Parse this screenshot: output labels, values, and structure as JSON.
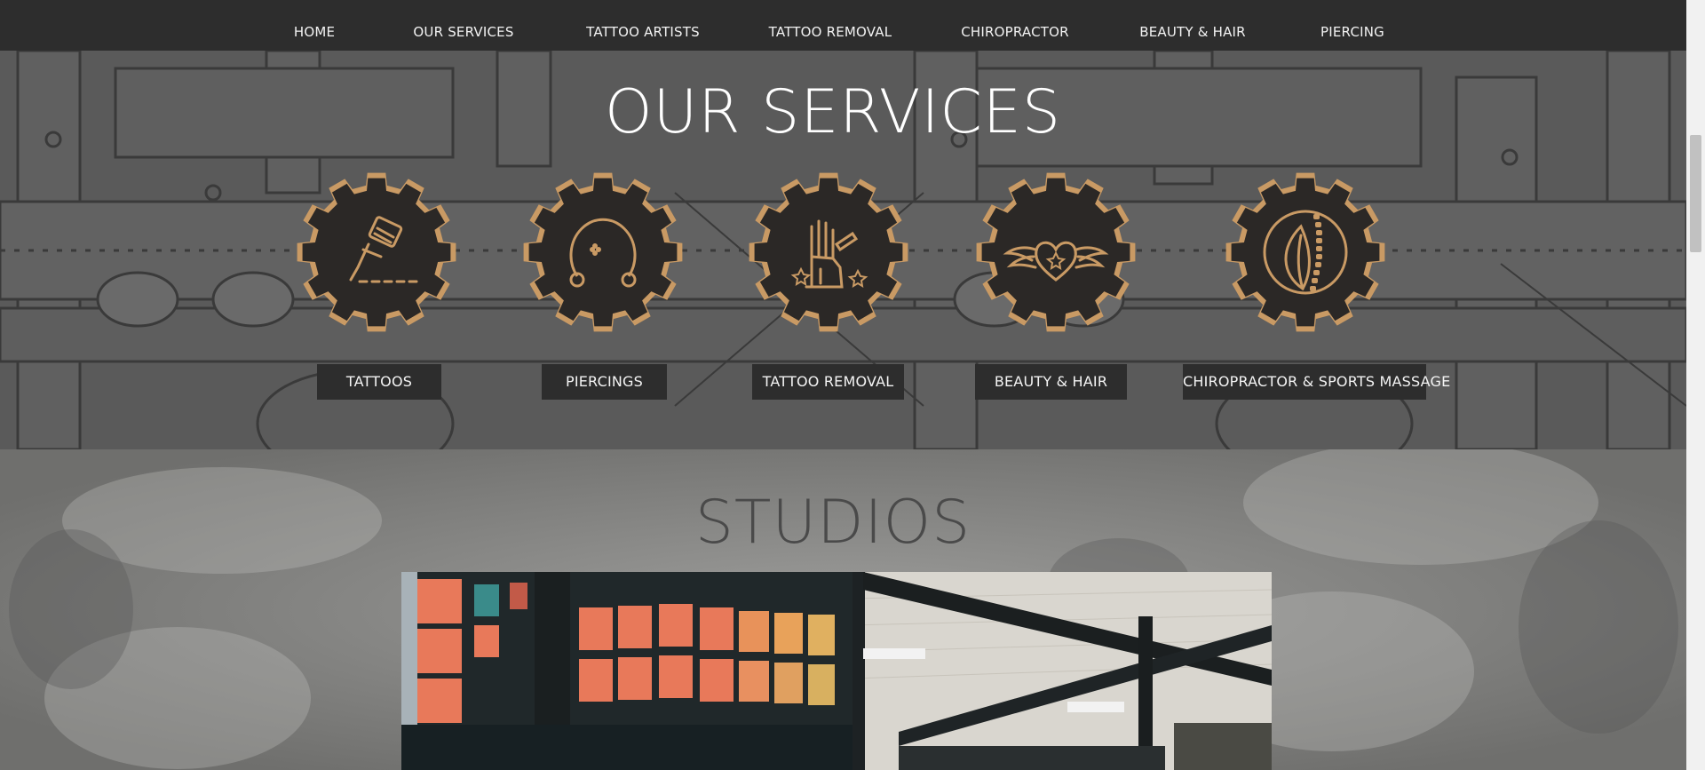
{
  "nav": {
    "items": [
      {
        "label": "HOME"
      },
      {
        "label": "OUR SERVICES"
      },
      {
        "label": "TATTOO ARTISTS"
      },
      {
        "label": "TATTOO REMOVAL"
      },
      {
        "label": "CHIROPRACTOR"
      },
      {
        "label": "BEAUTY & HAIR"
      },
      {
        "label": "PIERCING"
      }
    ]
  },
  "services": {
    "title": "OUR SERVICES",
    "items": [
      {
        "label": "TATTOOS",
        "icon": "tattoo-machine-icon"
      },
      {
        "label": "PIERCINGS",
        "icon": "piercing-ring-icon"
      },
      {
        "label": "TATTOO REMOVAL",
        "icon": "tattooed-hand-laser-icon"
      },
      {
        "label": "BEAUTY & HAIR",
        "icon": "winged-heart-icon"
      },
      {
        "label": "CHIROPRACTOR & SPORTS MASSAGE",
        "icon": "spine-leaf-icon"
      }
    ]
  },
  "studios": {
    "title": "STUDIOS"
  },
  "colors": {
    "nav_bg": "#2d2d2d",
    "services_bg": "#5a5a5a",
    "gear_fill": "#2b2826",
    "gear_accent": "#c99a64",
    "button_bg": "#2d2d2d",
    "studios_bg": "#8a8a88"
  }
}
